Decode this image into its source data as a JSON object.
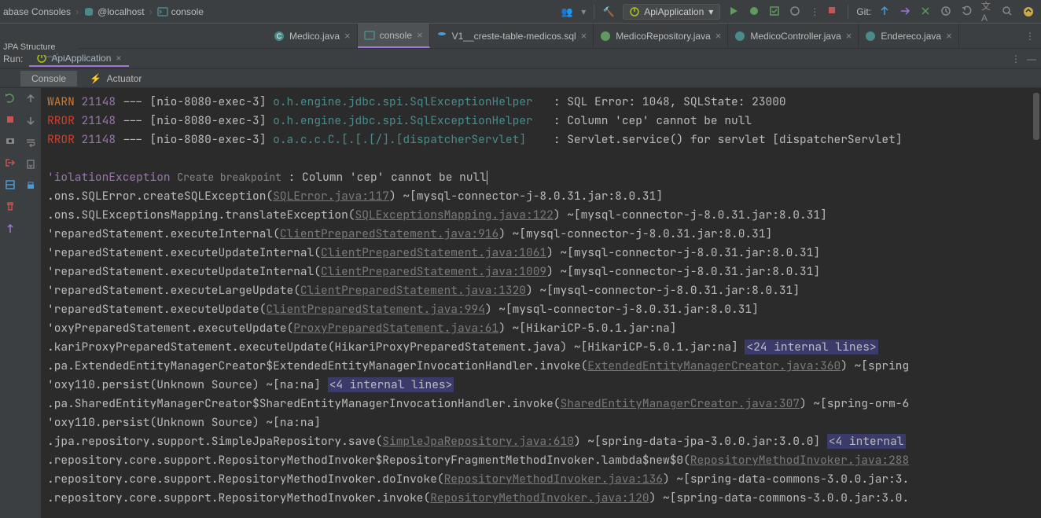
{
  "breadcrumb": {
    "item1": "abase Consoles",
    "item2": "@localhost",
    "item3": "console"
  },
  "side_label": "JPA Structure",
  "run_label": "Run:",
  "run_config_label": "ApiApplication",
  "run_tab_label": "ApiApplication",
  "git_label": "Git:",
  "tabs": [
    {
      "label": "Medico.java",
      "icon": "class"
    },
    {
      "label": "console",
      "icon": "db",
      "active": true
    },
    {
      "label": "V1__creste-table-medicos.sql",
      "icon": "db"
    },
    {
      "label": "MedicoRepository.java",
      "icon": "spring"
    },
    {
      "label": "MedicoController.java",
      "icon": "class"
    },
    {
      "label": "Endereco.java",
      "icon": "class"
    }
  ],
  "console_tabs": {
    "console": "Console",
    "actuator": "Actuator"
  },
  "log": {
    "l1_warn": "WARN",
    "l1_pid": "21148",
    "l1_thread": " --- [nio-8080-exec-3] ",
    "l1_logger": "o.h.engine.jdbc.spi.SqlExceptionHelper",
    "l1_msg": "   : SQL Error: 1048, SQLState: 23000",
    "l2_error": "RROR",
    "l2_pid": "21148",
    "l2_thread": " --- [nio-8080-exec-3] ",
    "l2_logger": "o.h.engine.jdbc.spi.SqlExceptionHelper",
    "l2_msg": "   : Column 'cep' cannot be null",
    "l3_error": "RROR",
    "l3_pid": "21148",
    "l3_thread": " --- [nio-8080-exec-3] ",
    "l3_logger": "o.a.c.c.C.[.[.[/].[dispatcherServlet]",
    "l3_msg": "    : Servlet.service() for servlet [dispatcherServlet]",
    "l4_exc": "'iolationException",
    "l4_bp": "Create breakpoint",
    "l4_msg": " : Column 'cep' cannot be null",
    "l5_a": ".ons.SQLError.createSQLException(",
    "l5_link": "SQLError.java:117",
    "l5_b": ") ~[mysql-connector-j-8.0.31.jar:8.0.31]",
    "l6_a": ".ons.SQLExceptionsMapping.translateException(",
    "l6_link": "SQLExceptionsMapping.java:122",
    "l6_b": ") ~[mysql-connector-j-8.0.31.jar:8.0.31]",
    "l7_a": "'reparedStatement.executeInternal(",
    "l7_link": "ClientPreparedStatement.java:916",
    "l7_b": ") ~[mysql-connector-j-8.0.31.jar:8.0.31]",
    "l8_a": "'reparedStatement.executeUpdateInternal(",
    "l8_link": "ClientPreparedStatement.java:1061",
    "l8_b": ") ~[mysql-connector-j-8.0.31.jar:8.0.31]",
    "l9_a": "'reparedStatement.executeUpdateInternal(",
    "l9_link": "ClientPreparedStatement.java:1009",
    "l9_b": ") ~[mysql-connector-j-8.0.31.jar:8.0.31]",
    "l10_a": "'reparedStatement.executeLargeUpdate(",
    "l10_link": "ClientPreparedStatement.java:1320",
    "l10_b": ") ~[mysql-connector-j-8.0.31.jar:8.0.31]",
    "l11_a": "'reparedStatement.executeUpdate(",
    "l11_link": "ClientPreparedStatement.java:994",
    "l11_b": ") ~[mysql-connector-j-8.0.31.jar:8.0.31]",
    "l12_a": "'oxyPreparedStatement.executeUpdate(",
    "l12_link": "ProxyPreparedStatement.java:61",
    "l12_b": ") ~[HikariCP-5.0.1.jar:na]",
    "l13_a": ".kariProxyPreparedStatement.executeUpdate(HikariProxyPreparedStatement.java) ~[HikariCP-5.0.1.jar:na] ",
    "l13_int": "<24 internal lines>",
    "l14_a": ".pa.ExtendedEntityManagerCreator$ExtendedEntityManagerInvocationHandler.invoke(",
    "l14_link": "ExtendedEntityManagerCreator.java:360",
    "l14_b": ") ~[spring",
    "l15_a": "'oxy110.persist(Unknown Source) ~[na:na] ",
    "l15_int": "<4 internal lines>",
    "l16_a": ".pa.SharedEntityManagerCreator$SharedEntityManagerInvocationHandler.invoke(",
    "l16_link": "SharedEntityManagerCreator.java:307",
    "l16_b": ") ~[spring-orm-6",
    "l17_a": "'oxy110.persist(Unknown Source) ~[na:na]",
    "l18_a": ".jpa.repository.support.SimpleJpaRepository.save(",
    "l18_link": "SimpleJpaRepository.java:610",
    "l18_b": ") ~[spring-data-jpa-3.0.0.jar:3.0.0] ",
    "l18_int": "<4 internal",
    "l19_a": ".repository.core.support.RepositoryMethodInvoker$RepositoryFragmentMethodInvoker.lambda$new$0(",
    "l19_link": "RepositoryMethodInvoker.java:288",
    "l20_a": ".repository.core.support.RepositoryMethodInvoker.doInvoke(",
    "l20_link": "RepositoryMethodInvoker.java:136",
    "l20_b": ") ~[spring-data-commons-3.0.0.jar:3.",
    "l21_a": ".repository.core.support.RepositoryMethodInvoker.invoke(",
    "l21_link": "RepositoryMethodInvoker.java:120",
    "l21_b": ") ~[spring-data-commons-3.0.0.jar:3.0."
  },
  "icons": {
    "users": "👥",
    "hammer": "🔨"
  }
}
